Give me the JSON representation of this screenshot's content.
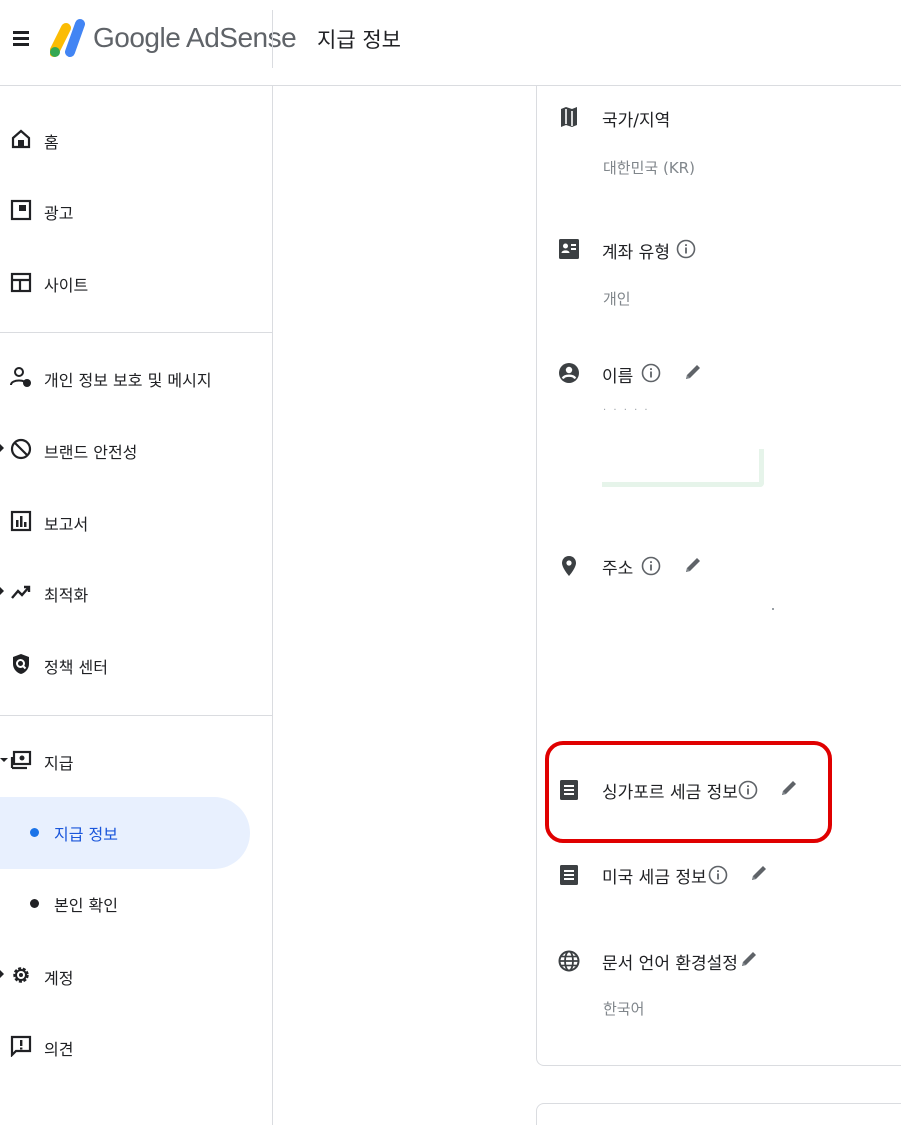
{
  "header": {
    "brand": "Google AdSense",
    "page_title": "지급 정보"
  },
  "sidebar": {
    "items": [
      {
        "label": "홈",
        "icon": "home-icon"
      },
      {
        "label": "광고",
        "icon": "ads-icon"
      },
      {
        "label": "사이트",
        "icon": "sites-icon"
      },
      {
        "label": "개인 정보 보호 및 메시지",
        "icon": "privacy-messaging-icon"
      },
      {
        "label": "브랜드 안전성",
        "icon": "block-icon"
      },
      {
        "label": "보고서",
        "icon": "report-icon"
      },
      {
        "label": "최적화",
        "icon": "trending-icon"
      },
      {
        "label": "정책 센터",
        "icon": "policy-shield-icon"
      },
      {
        "label": "지급",
        "icon": "payments-icon"
      },
      {
        "label": "계정",
        "icon": "gear-icon"
      },
      {
        "label": "의견",
        "icon": "feedback-icon"
      }
    ],
    "sub_items": [
      {
        "label": "지급 정보",
        "active": true
      },
      {
        "label": "본인 확인",
        "active": false
      }
    ]
  },
  "payment_info": {
    "country": {
      "title": "국가/지역",
      "value": "대한민국 (KR)",
      "icon": "map-icon"
    },
    "account_type": {
      "title": "계좌 유형",
      "value": "개인",
      "icon": "contact-card-icon"
    },
    "name": {
      "title": "이름",
      "masked_value": "· · · · ·",
      "icon": "account-circle-icon"
    },
    "address": {
      "title": "주소",
      "icon": "location-pin-icon"
    },
    "sg_tax": {
      "title": "싱가포르 세금 정보",
      "icon": "document-list-icon"
    },
    "us_tax": {
      "title": "미국 세금 정보",
      "icon": "document-list-icon"
    },
    "doc_lang": {
      "title": "문서 언어 환경설정",
      "value": "한국어",
      "icon": "globe-icon"
    }
  },
  "colors": {
    "active_bg": "#e8f0fe",
    "active_text": "#1a56db",
    "highlight": "#e00000",
    "icon": "#3c4043"
  }
}
